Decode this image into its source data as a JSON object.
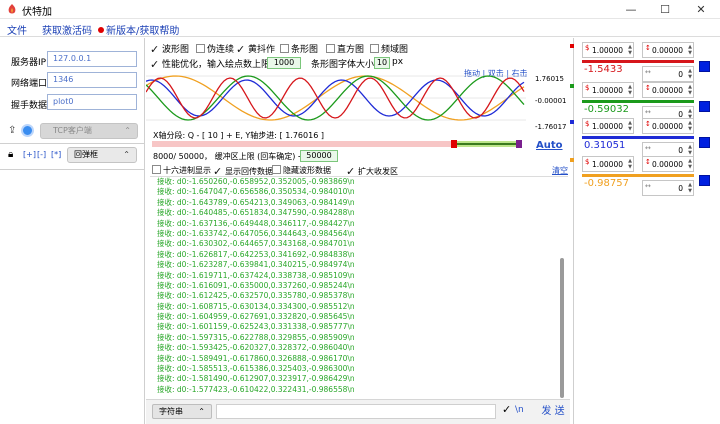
{
  "window": {
    "title": "伏特加",
    "min": "—",
    "max": "☐",
    "close": "✕"
  },
  "menu": {
    "file": "文件",
    "activation": "获取激活码",
    "update": "新版本/获取帮助"
  },
  "connection": {
    "server_ip_label": "服务器IP",
    "server_ip_value": "127.0.0.1",
    "port_label": "网络端口",
    "port_value": "1346",
    "handshake_label": "握手数据",
    "handshake_value": "plot0",
    "tcp_mode": "TCP客户端",
    "tags": [
      "[+]",
      "[-]",
      "[*]"
    ],
    "popup_mode": "回弹框"
  },
  "options": {
    "waveform": "波形图",
    "pseudo_continuous": "伪连续",
    "jitter": "黄抖作",
    "bar": "条形图",
    "histogram": "直方图",
    "frequency": "频域图",
    "perf_label": "性能优化，输入绘点数上限 →",
    "perf_value": "1000",
    "bar_font_label": "条形图字体大小 →",
    "bar_font_value": "10",
    "bar_font_unit": "px"
  },
  "plot": {
    "nav": "拖动 | 双击 | 右击",
    "y_top": "1.76015",
    "y_mid": "-0.00001",
    "y_bot": "-1.76017",
    "x_seg": "X轴分段:  Q - [ 10 ] + E,   Y轴步进: [ 1.76016 ]",
    "auto": "Auto",
    "buffer_label": "8000/ 50000， 缓冲区上限 (回车确定) →",
    "buffer_value": "50000",
    "colors": {
      "blue": "#1f2bd6",
      "red": "#d6161b",
      "green": "#1b9a1b",
      "orange": "#f0a020"
    }
  },
  "log_opts": {
    "hex": "十六进制显示",
    "echo": "显示回传数据",
    "hide_wave": "隐藏波形数据",
    "expand": "扩大收发区",
    "clear": "清空"
  },
  "log_prefix": "接收: ",
  "log_lines": [
    "d0:-1.650260,-0.658952,0.352005,-0.983869\\n",
    "d0:-1.647047,-0.656586,0.350534,-0.984010\\n",
    "d0:-1.643789,-0.654213,0.349063,-0.984149\\n",
    "d0:-1.640485,-0.651834,0.347590,-0.984288\\n",
    "d0:-1.637136,-0.649448,0.346117,-0.984427\\n",
    "d0:-1.633742,-0.647056,0.344643,-0.984564\\n",
    "d0:-1.630302,-0.644657,0.343168,-0.984701\\n",
    "d0:-1.626817,-0.642253,0.341692,-0.984838\\n",
    "d0:-1.623287,-0.639841,0.340215,-0.984974\\n",
    "d0:-1.619711,-0.637424,0.338738,-0.985109\\n",
    "d0:-1.616091,-0.635000,0.337260,-0.985244\\n",
    "d0:-1.612425,-0.632570,0.335780,-0.985378\\n",
    "d0:-1.608715,-0.630134,0.334300,-0.985512\\n",
    "d0:-1.604959,-0.627691,0.332820,-0.985645\\n",
    "d0:-1.601159,-0.625243,0.331338,-0.985777\\n",
    "d0:-1.597315,-0.622788,0.329855,-0.985909\\n",
    "d0:-1.593425,-0.620327,0.328372,-0.986040\\n",
    "d0:-1.589491,-0.617860,0.326888,-0.986170\\n",
    "d0:-1.585513,-0.615386,0.325403,-0.986300\\n",
    "d0:-1.581490,-0.612907,0.323917,-0.986429\\n",
    "d0:-1.577423,-0.610422,0.322431,-0.986558\\n"
  ],
  "send": {
    "format": "字符串",
    "newline": "\\n",
    "send": "发 送"
  },
  "channels": [
    {
      "scale": "1.00000",
      "offset": "0.00000",
      "value": "-1.5433",
      "zoom": "0",
      "color": "#d6161b"
    },
    {
      "scale": "1.00000",
      "offset": "0.00000",
      "value": "-0.59032",
      "zoom": "0",
      "color": "#1b9a1b"
    },
    {
      "scale": "1.00000",
      "offset": "0.00000",
      "value": "0.31051",
      "zoom": "0",
      "color": "#1f2bd6"
    },
    {
      "scale": "1.00000",
      "offset": "0.00000",
      "value": "-0.98757",
      "zoom": "0",
      "color": "#f0a020"
    }
  ]
}
